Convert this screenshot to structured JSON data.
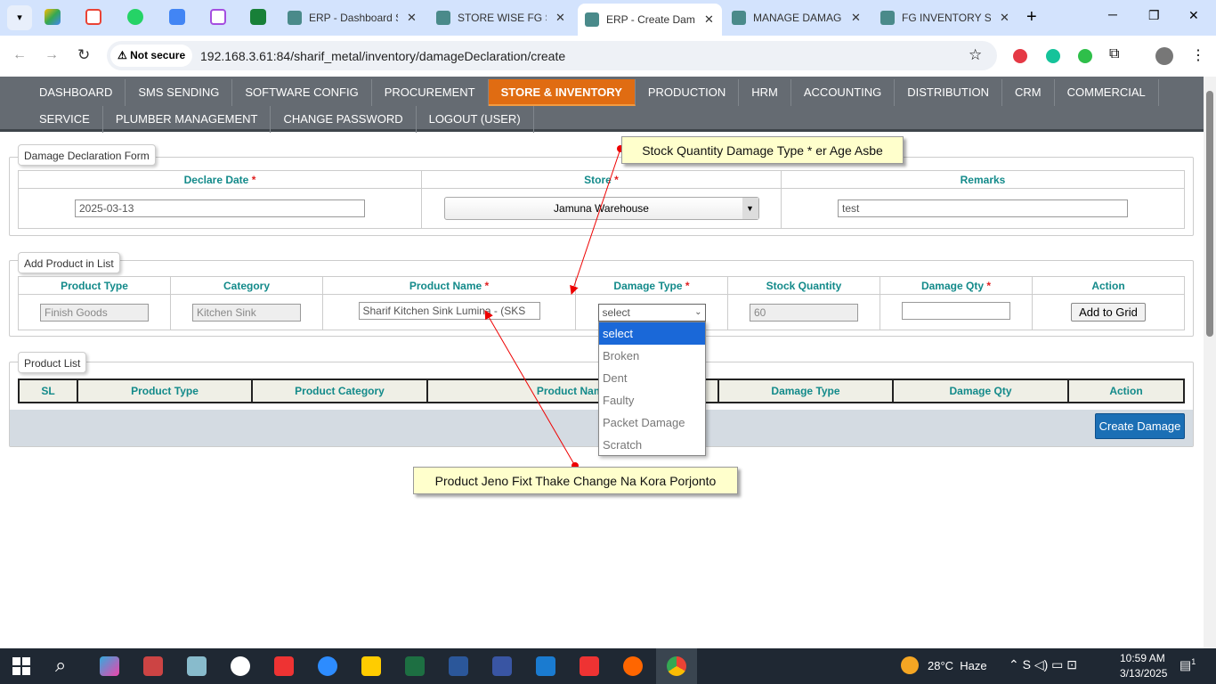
{
  "browser": {
    "tabs": [
      {
        "title": "ERP - Dashboard S",
        "active": false
      },
      {
        "title": "STORE WISE FG ST",
        "active": false
      },
      {
        "title": "ERP - Create Dam",
        "active": true
      },
      {
        "title": "MANAGE DAMAGE",
        "active": false
      },
      {
        "title": "FG INVENTORY ST",
        "active": false
      }
    ],
    "security_label": "Not secure",
    "url": "192.168.3.61:84/sharif_metal/inventory/damageDeclaration/create"
  },
  "nav": {
    "row1": [
      "DASHBOARD",
      "SMS SENDING",
      "SOFTWARE CONFIG",
      "PROCUREMENT",
      "STORE & INVENTORY",
      "PRODUCTION",
      "HRM",
      "ACCOUNTING",
      "DISTRIBUTION",
      "CRM",
      "COMMERCIAL"
    ],
    "row2": [
      "SERVICE",
      "PLUMBER MANAGEMENT",
      "CHANGE PASSWORD",
      "LOGOUT (USER)"
    ],
    "active": "STORE & INVENTORY"
  },
  "form": {
    "legend": "Damage Declaration Form",
    "declare_date_label": "Declare Date",
    "declare_date": "2025-03-13",
    "store_label": "Store",
    "store": "Jamuna Warehouse",
    "remarks_label": "Remarks",
    "remarks": "test"
  },
  "add": {
    "legend": "Add Product in List",
    "headers": [
      "Product Type",
      "Category",
      "Product Name",
      "Damage Type",
      "Stock Quantity",
      "Damage Qty",
      "Action"
    ],
    "product_type": "Finish Goods",
    "category": "Kitchen Sink",
    "product_name": "Sharif Kitchen Sink Lumina - (SKS",
    "damage_type": "select",
    "stock_qty": "60",
    "damage_qty": "",
    "add_button": "Add to Grid",
    "damage_options": [
      "select",
      "Broken",
      "Dent",
      "Faulty",
      "Packet Damage",
      "Scratch"
    ]
  },
  "list": {
    "legend": "Product List",
    "headers": [
      "SL",
      "Product Type",
      "Product Category",
      "Product Name",
      "Damage Type",
      "Damage Qty",
      "Action"
    ],
    "create_button": "Create Damage"
  },
  "annotations": {
    "top": "Stock Quantity Damage Type * er Age Asbe",
    "bottom": "Product Jeno Fixt Thake Change Na Kora Porjonto"
  },
  "taskbar": {
    "weather": "28°C  Haze",
    "time": "10:59 AM",
    "date": "3/13/2025",
    "notifications": "1"
  },
  "required_mark": "*"
}
